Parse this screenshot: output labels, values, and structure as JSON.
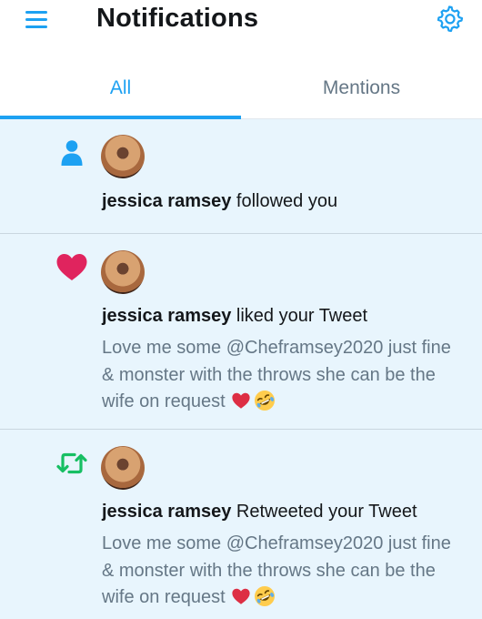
{
  "header": {
    "title": "Notifications",
    "menu_icon": "hamburger-menu-icon",
    "settings_icon": "gear-icon"
  },
  "tabs": [
    {
      "label": "All",
      "active": true
    },
    {
      "label": "Mentions",
      "active": false
    }
  ],
  "colors": {
    "accent": "#1da1f2",
    "like": "#e0245e",
    "retweet": "#17bf63",
    "unread_bg": "#e8f5fd",
    "secondary_text": "#657786"
  },
  "notifications": [
    {
      "type": "follow",
      "icon": "person-icon",
      "user": "jessica ramsey",
      "action": "followed you",
      "tweet_text": "",
      "emojis": []
    },
    {
      "type": "like",
      "icon": "heart-icon",
      "user": "jessica ramsey",
      "action": "liked your Tweet",
      "tweet_text": "Love me some @Cheframsey2020 just fine & monster with the throws she can be the wife on request",
      "emojis": [
        "heart-emoji",
        "rolling-laughing-emoji"
      ]
    },
    {
      "type": "retweet",
      "icon": "retweet-icon",
      "user": "jessica ramsey",
      "action": "Retweeted your Tweet",
      "tweet_text": "Love me some @Cheframsey2020 just fine & monster with the throws she can be the wife on request",
      "emojis": [
        "heart-emoji",
        "rolling-laughing-emoji"
      ]
    }
  ]
}
